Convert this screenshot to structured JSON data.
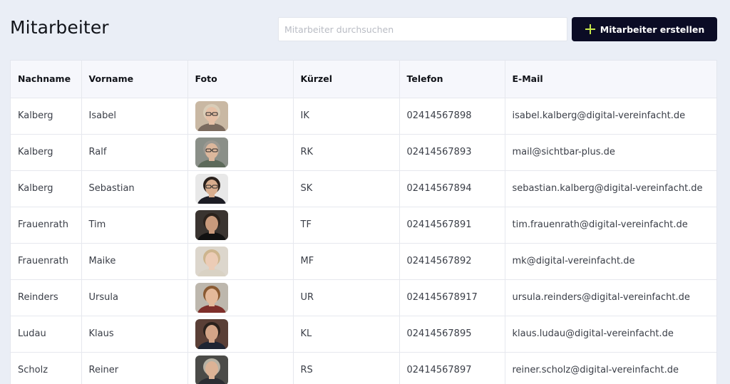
{
  "header": {
    "title": "Mitarbeiter"
  },
  "search": {
    "placeholder": "Mitarbeiter durchsuchen",
    "value": ""
  },
  "create_button": {
    "label": "Mitarbeiter erstellen",
    "icon": "plus-icon",
    "icon_color": "#c6e84a",
    "background": "#0b0c25"
  },
  "table": {
    "columns": [
      "Nachname",
      "Vorname",
      "Foto",
      "Kürzel",
      "Telefon",
      "E-Mail"
    ],
    "rows": [
      {
        "nachname": "Kalberg",
        "vorname": "Isabel",
        "kuerzel": "IK",
        "telefon": "02414567898",
        "email": "isabel.kalberg@digital-vereinfacht.de",
        "photo": {
          "bg": "#c9b8a3",
          "hair": "#d9cdb8",
          "skin": "#e6c0a6",
          "shirt": "#7a6a5e",
          "glasses": true
        }
      },
      {
        "nachname": "Kalberg",
        "vorname": "Ralf",
        "kuerzel": "RK",
        "telefon": "02414567893",
        "email": "mail@sichtbar-plus.de",
        "photo": {
          "bg": "#8a8f88",
          "hair": "#9a9891",
          "skin": "#dcb79c",
          "shirt": "#5d6a5a",
          "glasses": true
        }
      },
      {
        "nachname": "Kalberg",
        "vorname": "Sebastian",
        "kuerzel": "SK",
        "telefon": "02414567894",
        "email": "sebastian.kalberg@digital-vereinfacht.de",
        "photo": {
          "bg": "#e8e8e8",
          "hair": "#2a211c",
          "skin": "#d8ad8e",
          "shirt": "#1c1c24",
          "glasses": true
        }
      },
      {
        "nachname": "Frauenrath",
        "vorname": "Tim",
        "kuerzel": "TF",
        "telefon": "02414567891",
        "email": "tim.frauenrath@digital-vereinfacht.de",
        "photo": {
          "bg": "#3a3430",
          "hair": "#2b221c",
          "skin": "#c99a7c",
          "shirt": "#111111",
          "glasses": false
        }
      },
      {
        "nachname": "Frauenrath",
        "vorname": "Maike",
        "kuerzel": "MF",
        "telefon": "02414567892",
        "email": "mk@digital-vereinfacht.de",
        "photo": {
          "bg": "#dcd6cc",
          "hair": "#cdb58e",
          "skin": "#ecccb6",
          "shirt": "#d9d2c4",
          "glasses": false
        }
      },
      {
        "nachname": "Reinders",
        "vorname": "Ursula",
        "kuerzel": "UR",
        "telefon": "024145678917",
        "email": "ursula.reinders@digital-vereinfacht.de",
        "photo": {
          "bg": "#bdb7ad",
          "hair": "#8a5a32",
          "skin": "#e4b99a",
          "shirt": "#7e2f2a",
          "glasses": false
        }
      },
      {
        "nachname": "Ludau",
        "vorname": "Klaus",
        "kuerzel": "KL",
        "telefon": "02414567895",
        "email": "klaus.ludau@digital-vereinfacht.de",
        "photo": {
          "bg": "#5a3f36",
          "hair": "#2a211c",
          "skin": "#d3a487",
          "shirt": "#1f2533",
          "glasses": false
        }
      },
      {
        "nachname": "Scholz",
        "vorname": "Reiner",
        "kuerzel": "RS",
        "telefon": "02414567897",
        "email": "reiner.scholz@digital-vereinfacht.de",
        "photo": {
          "bg": "#4b4b48",
          "hair": "#b7b2a4",
          "skin": "#dcb396",
          "shirt": "#2b2d33",
          "glasses": false
        }
      }
    ]
  }
}
